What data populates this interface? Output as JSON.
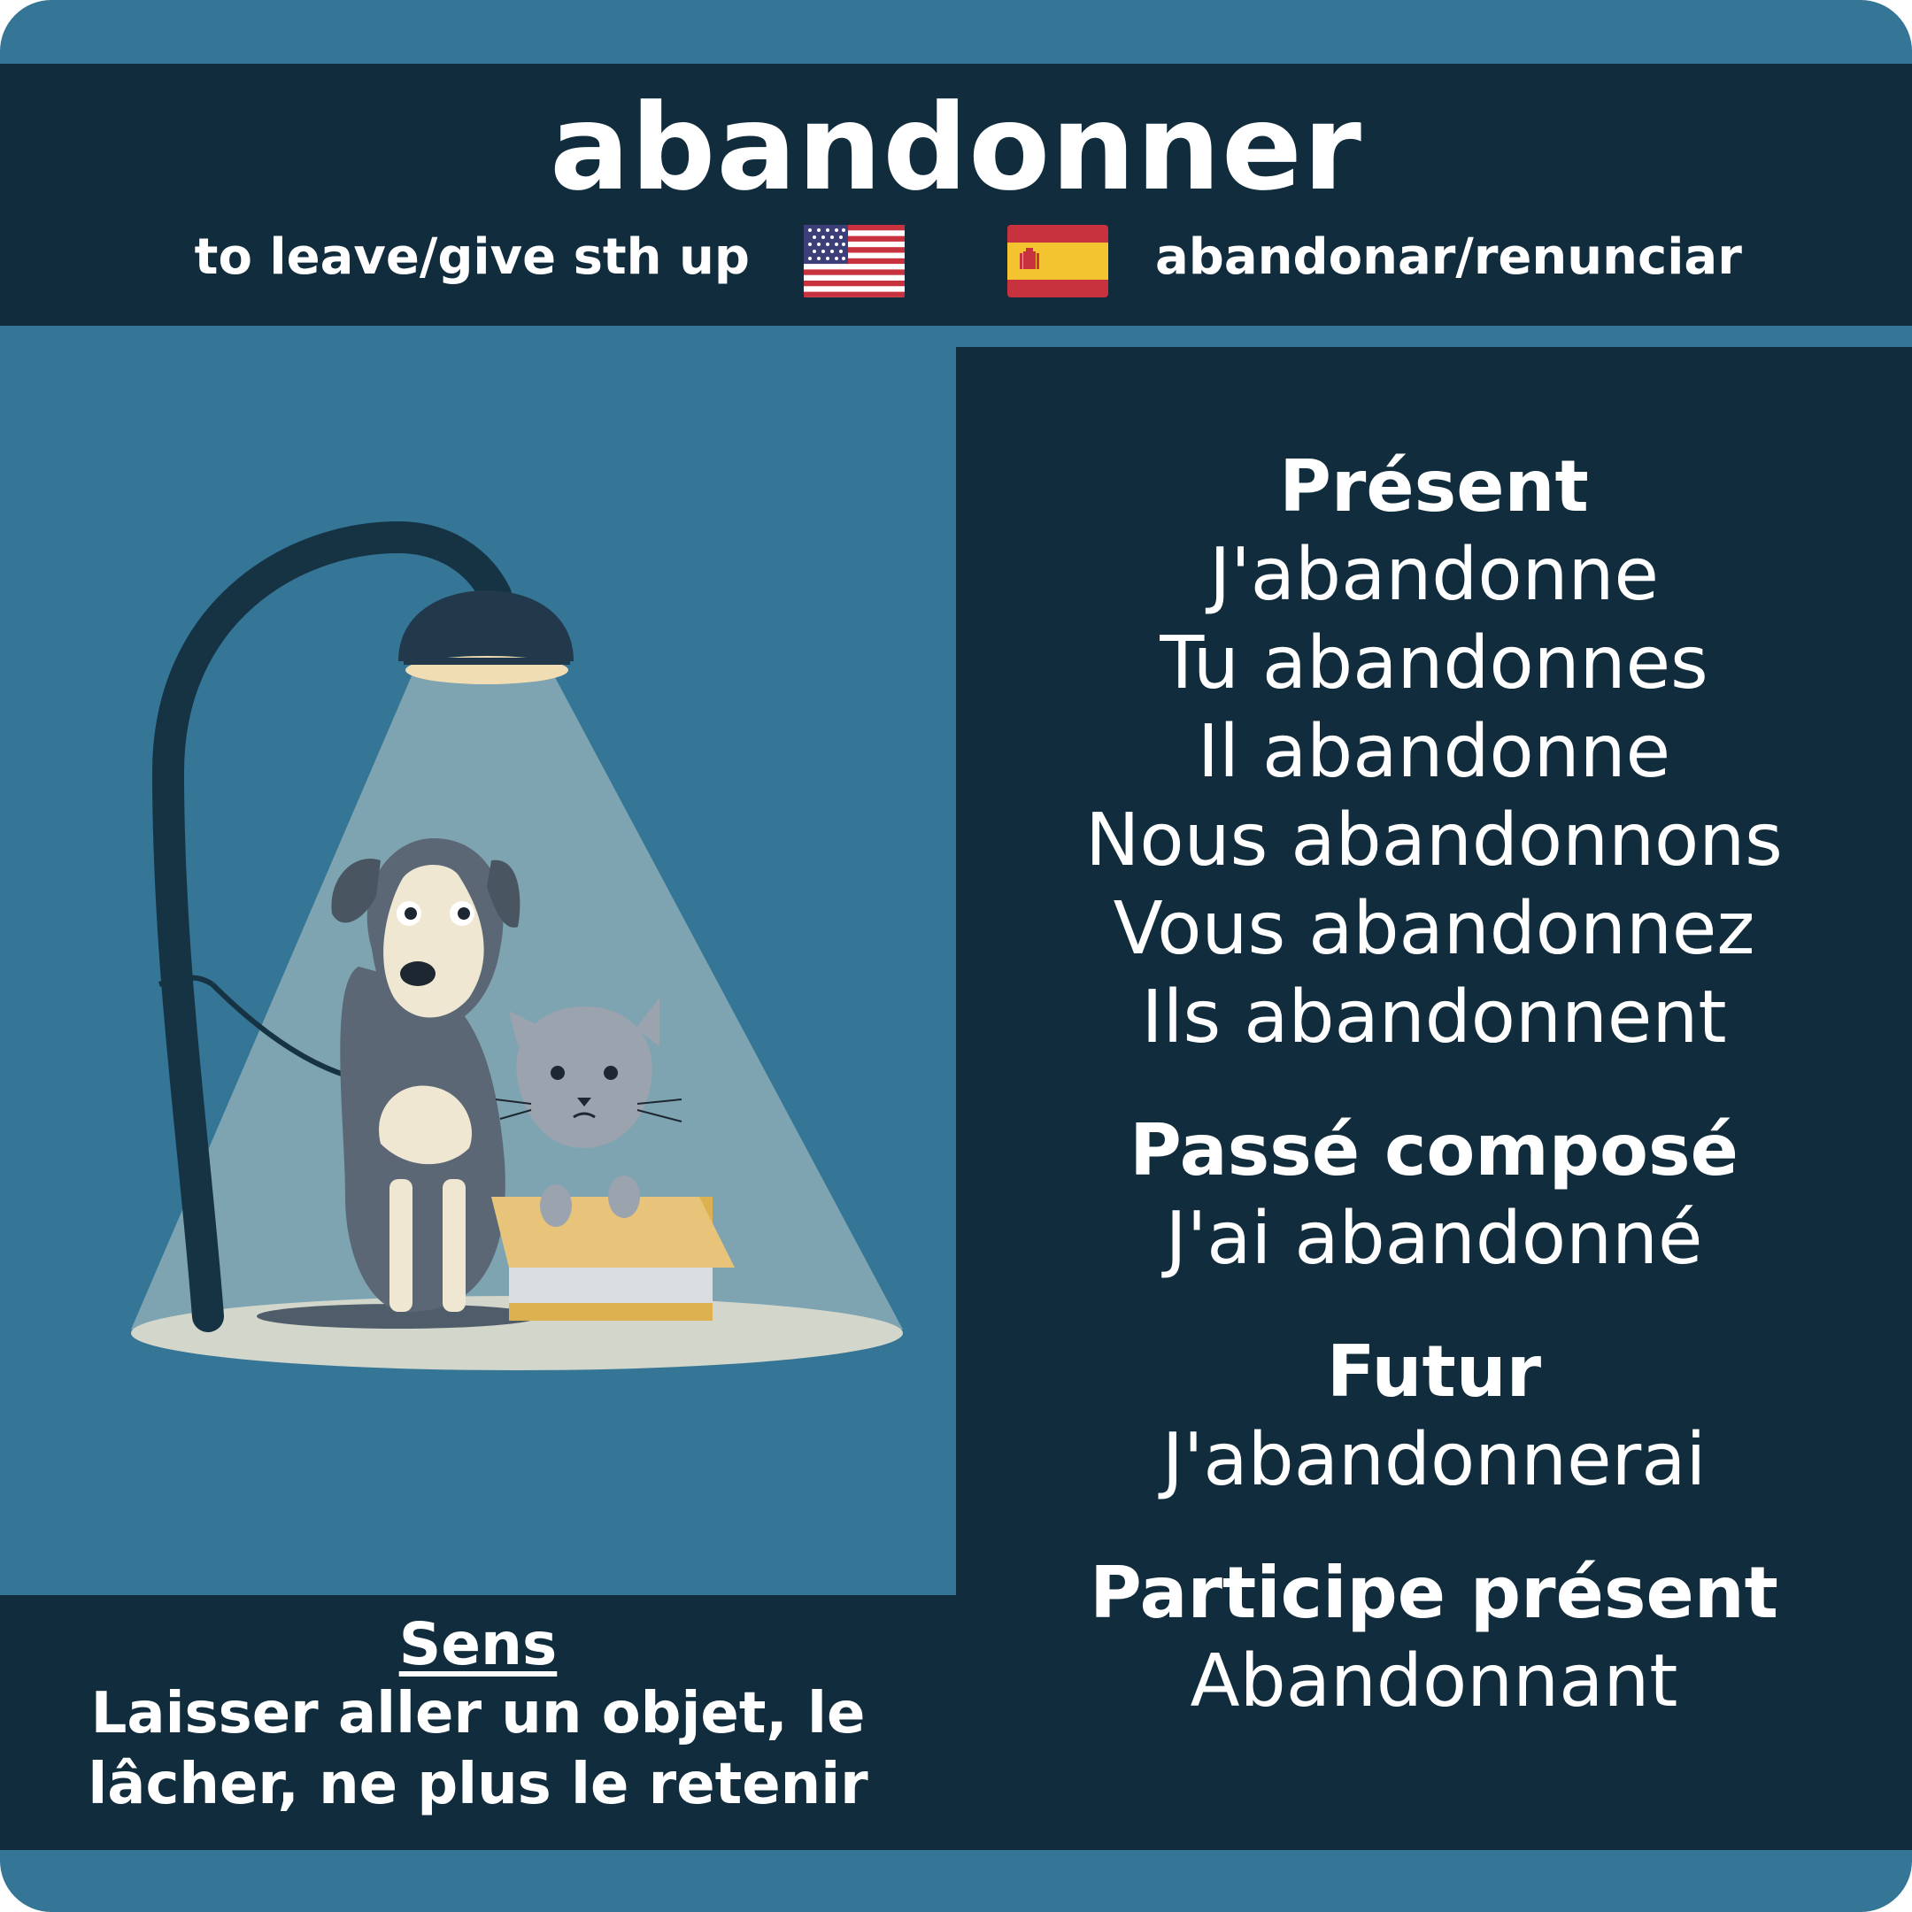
{
  "verb": "abandonner",
  "translations": {
    "english": "to leave/give sth up",
    "spanish": "abandonar/renunciar",
    "english_flag_icon": "us-flag-icon",
    "spanish_flag_icon": "spain-flag-icon"
  },
  "conjugations": {
    "present": {
      "title": "Présent",
      "forms": [
        "J'abandonne",
        "Tu abandonnes",
        "Il abandonne",
        "Nous abandonnons",
        "Vous abandonnez",
        "Ils abandonnent"
      ]
    },
    "passe_compose": {
      "title": "Passé composé",
      "form": "J'ai abandonné"
    },
    "futur": {
      "title": "Futur",
      "form": "J'abandonnerai"
    },
    "participe_present": {
      "title": "Participe présent",
      "form": "Abandonnant"
    }
  },
  "meaning": {
    "title": "Sens",
    "lines": [
      "Laisser aller un objet, le",
      "lâcher, ne plus le retenir"
    ]
  },
  "colors": {
    "card_background": "#357596",
    "panel_dark": "#112c3c",
    "text": "#ffffff",
    "light_beam": "#7ea4b1"
  }
}
